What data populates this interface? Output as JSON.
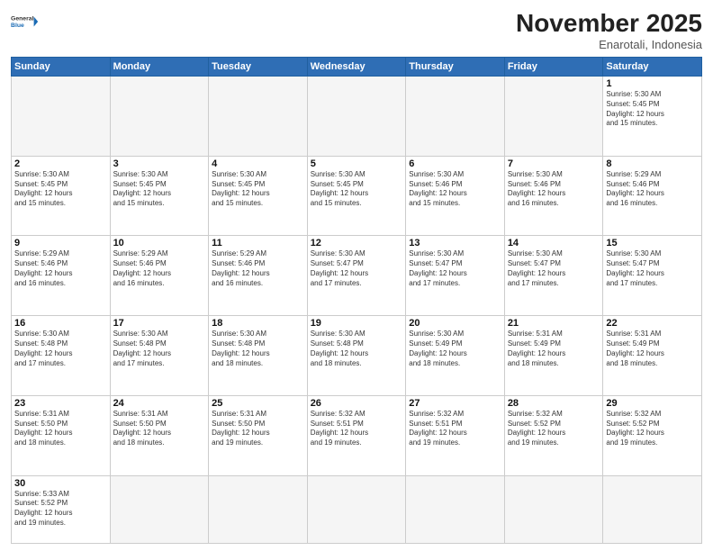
{
  "header": {
    "logo_general": "General",
    "logo_blue": "Blue",
    "month_year": "November 2025",
    "location": "Enarotali, Indonesia"
  },
  "days_of_week": [
    "Sunday",
    "Monday",
    "Tuesday",
    "Wednesday",
    "Thursday",
    "Friday",
    "Saturday"
  ],
  "weeks": [
    [
      {
        "day": "",
        "info": "",
        "empty": true
      },
      {
        "day": "",
        "info": "",
        "empty": true
      },
      {
        "day": "",
        "info": "",
        "empty": true
      },
      {
        "day": "",
        "info": "",
        "empty": true
      },
      {
        "day": "",
        "info": "",
        "empty": true
      },
      {
        "day": "",
        "info": "",
        "empty": true
      },
      {
        "day": "1",
        "info": "Sunrise: 5:30 AM\nSunset: 5:45 PM\nDaylight: 12 hours\nand 15 minutes."
      }
    ],
    [
      {
        "day": "2",
        "info": "Sunrise: 5:30 AM\nSunset: 5:45 PM\nDaylight: 12 hours\nand 15 minutes."
      },
      {
        "day": "3",
        "info": "Sunrise: 5:30 AM\nSunset: 5:45 PM\nDaylight: 12 hours\nand 15 minutes."
      },
      {
        "day": "4",
        "info": "Sunrise: 5:30 AM\nSunset: 5:45 PM\nDaylight: 12 hours\nand 15 minutes."
      },
      {
        "day": "5",
        "info": "Sunrise: 5:30 AM\nSunset: 5:45 PM\nDaylight: 12 hours\nand 15 minutes."
      },
      {
        "day": "6",
        "info": "Sunrise: 5:30 AM\nSunset: 5:46 PM\nDaylight: 12 hours\nand 15 minutes."
      },
      {
        "day": "7",
        "info": "Sunrise: 5:30 AM\nSunset: 5:46 PM\nDaylight: 12 hours\nand 16 minutes."
      },
      {
        "day": "8",
        "info": "Sunrise: 5:29 AM\nSunset: 5:46 PM\nDaylight: 12 hours\nand 16 minutes."
      }
    ],
    [
      {
        "day": "9",
        "info": "Sunrise: 5:29 AM\nSunset: 5:46 PM\nDaylight: 12 hours\nand 16 minutes."
      },
      {
        "day": "10",
        "info": "Sunrise: 5:29 AM\nSunset: 5:46 PM\nDaylight: 12 hours\nand 16 minutes."
      },
      {
        "day": "11",
        "info": "Sunrise: 5:29 AM\nSunset: 5:46 PM\nDaylight: 12 hours\nand 16 minutes."
      },
      {
        "day": "12",
        "info": "Sunrise: 5:30 AM\nSunset: 5:47 PM\nDaylight: 12 hours\nand 17 minutes."
      },
      {
        "day": "13",
        "info": "Sunrise: 5:30 AM\nSunset: 5:47 PM\nDaylight: 12 hours\nand 17 minutes."
      },
      {
        "day": "14",
        "info": "Sunrise: 5:30 AM\nSunset: 5:47 PM\nDaylight: 12 hours\nand 17 minutes."
      },
      {
        "day": "15",
        "info": "Sunrise: 5:30 AM\nSunset: 5:47 PM\nDaylight: 12 hours\nand 17 minutes."
      }
    ],
    [
      {
        "day": "16",
        "info": "Sunrise: 5:30 AM\nSunset: 5:48 PM\nDaylight: 12 hours\nand 17 minutes."
      },
      {
        "day": "17",
        "info": "Sunrise: 5:30 AM\nSunset: 5:48 PM\nDaylight: 12 hours\nand 17 minutes."
      },
      {
        "day": "18",
        "info": "Sunrise: 5:30 AM\nSunset: 5:48 PM\nDaylight: 12 hours\nand 18 minutes."
      },
      {
        "day": "19",
        "info": "Sunrise: 5:30 AM\nSunset: 5:48 PM\nDaylight: 12 hours\nand 18 minutes."
      },
      {
        "day": "20",
        "info": "Sunrise: 5:30 AM\nSunset: 5:49 PM\nDaylight: 12 hours\nand 18 minutes."
      },
      {
        "day": "21",
        "info": "Sunrise: 5:31 AM\nSunset: 5:49 PM\nDaylight: 12 hours\nand 18 minutes."
      },
      {
        "day": "22",
        "info": "Sunrise: 5:31 AM\nSunset: 5:49 PM\nDaylight: 12 hours\nand 18 minutes."
      }
    ],
    [
      {
        "day": "23",
        "info": "Sunrise: 5:31 AM\nSunset: 5:50 PM\nDaylight: 12 hours\nand 18 minutes."
      },
      {
        "day": "24",
        "info": "Sunrise: 5:31 AM\nSunset: 5:50 PM\nDaylight: 12 hours\nand 18 minutes."
      },
      {
        "day": "25",
        "info": "Sunrise: 5:31 AM\nSunset: 5:50 PM\nDaylight: 12 hours\nand 19 minutes."
      },
      {
        "day": "26",
        "info": "Sunrise: 5:32 AM\nSunset: 5:51 PM\nDaylight: 12 hours\nand 19 minutes."
      },
      {
        "day": "27",
        "info": "Sunrise: 5:32 AM\nSunset: 5:51 PM\nDaylight: 12 hours\nand 19 minutes."
      },
      {
        "day": "28",
        "info": "Sunrise: 5:32 AM\nSunset: 5:52 PM\nDaylight: 12 hours\nand 19 minutes."
      },
      {
        "day": "29",
        "info": "Sunrise: 5:32 AM\nSunset: 5:52 PM\nDaylight: 12 hours\nand 19 minutes."
      }
    ],
    [
      {
        "day": "30",
        "info": "Sunrise: 5:33 AM\nSunset: 5:52 PM\nDaylight: 12 hours\nand 19 minutes.",
        "last": true
      },
      {
        "day": "",
        "info": "",
        "empty": true,
        "last": true
      },
      {
        "day": "",
        "info": "",
        "empty": true,
        "last": true
      },
      {
        "day": "",
        "info": "",
        "empty": true,
        "last": true
      },
      {
        "day": "",
        "info": "",
        "empty": true,
        "last": true
      },
      {
        "day": "",
        "info": "",
        "empty": true,
        "last": true
      },
      {
        "day": "",
        "info": "",
        "empty": true,
        "last": true
      }
    ]
  ]
}
